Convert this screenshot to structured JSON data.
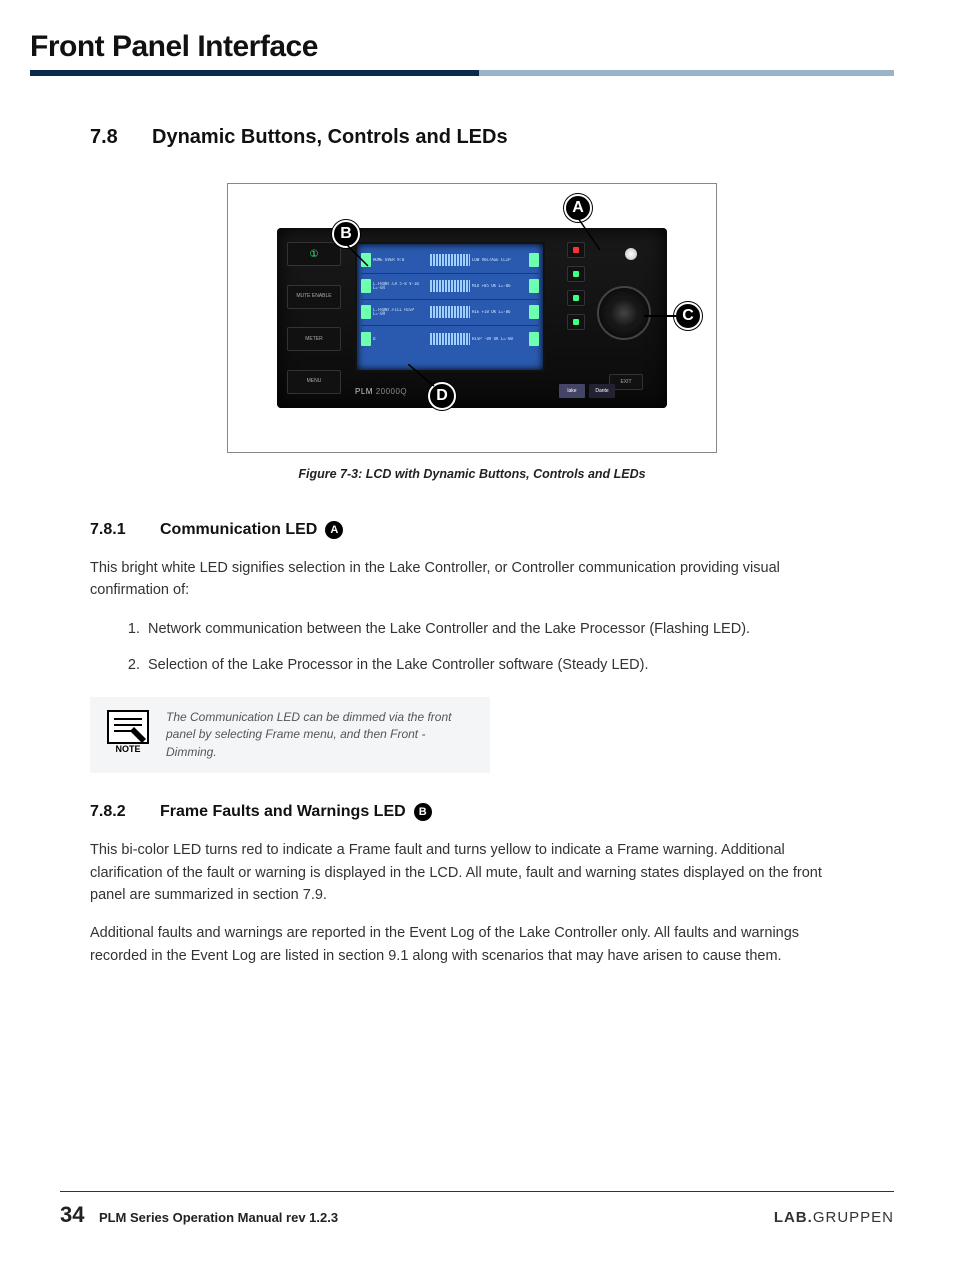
{
  "header": {
    "title": "Front Panel Interface"
  },
  "section": {
    "num": "7.8",
    "title": "Dynamic Buttons, Controls and LEDs"
  },
  "figure": {
    "caption": "Figure 7-3: LCD with Dynamic Buttons, Controls and LEDs",
    "callouts": {
      "a": "A",
      "b": "B",
      "c": "C",
      "d": "D"
    },
    "device": {
      "side_buttons": [
        "①",
        "MUTE\nENABLE",
        "METER",
        "MENU"
      ],
      "model_prefix": "PLM",
      "model_num": "20000Q",
      "exit": "EXIT",
      "logos": [
        "lake",
        "Dante"
      ],
      "lcd_rows": [
        {
          "left": "HOME\nOVER 9:0",
          "right": "LOW\nVOLTAGE CLIP"
        },
        {
          "left": "L.FRONT.LA 5-8\nV-10      L=-04",
          "right": "MID\n      +05\nOK    L=-06"
        },
        {
          "left": "L.FRONT.FILL\nHISP      L=-09",
          "right": "HIE\n      +10\nOK    L=-06"
        },
        {
          "left": "Ω",
          "right": "HISP\n      -09\nOK    L=-00"
        }
      ]
    }
  },
  "s781": {
    "num": "7.8.1",
    "title": "Communication LED",
    "badge": "A",
    "p1": "This bright white LED signifies selection in the Lake Controller, or Controller communication providing visual confirmation of:",
    "li1": "Network communication between the Lake Controller and the Lake Processor (Flashing LED).",
    "li2": "Selection of the Lake Processor in the Lake Controller software (Steady LED).",
    "note": "The Communication LED can be dimmed via the front panel by selecting Frame menu, and then Front - Dimming.",
    "note_label": "NOTE"
  },
  "s782": {
    "num": "7.8.2",
    "title": "Frame Faults and Warnings LED",
    "badge": "B",
    "p1": "This bi-color LED turns red to indicate a Frame fault and turns yellow to indicate a Frame warning. Additional clarification of the fault or warning is displayed in the LCD. All mute, fault and warning states displayed on the front panel are summarized in section 7.9.",
    "p2": "Additional faults and warnings are reported in the Event Log of the Lake Controller only. All faults and warnings recorded in the Event Log are listed in section 9.1 along with scenarios that may have arisen to cause them."
  },
  "footer": {
    "page": "34",
    "doc": "PLM Series Operation Manual rev 1.2.3",
    "brand_bold": "LAB.",
    "brand_light": "GRUPPEN"
  }
}
